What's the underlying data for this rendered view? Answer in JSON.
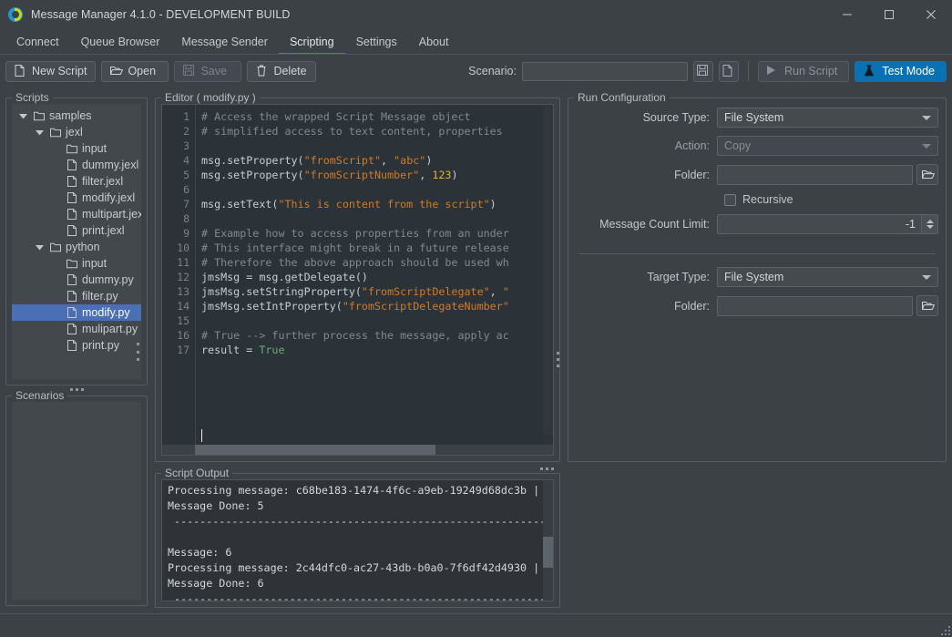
{
  "window": {
    "title": "Message Manager 4.1.0 - DEVELOPMENT BUILD",
    "minimize": "minimize-icon",
    "maximize": "maximize-icon",
    "close": "close-icon"
  },
  "tabs": [
    {
      "label": "Connect",
      "active": false
    },
    {
      "label": "Queue Browser",
      "active": false
    },
    {
      "label": "Message Sender",
      "active": false
    },
    {
      "label": "Scripting",
      "active": true
    },
    {
      "label": "Settings",
      "active": false
    },
    {
      "label": "About",
      "active": false
    }
  ],
  "toolbar": {
    "new_script": "New Script",
    "open": "Open",
    "save": "Save",
    "delete": "Delete",
    "scenario_label": "Scenario:",
    "scenario_value": "",
    "scenario_placeholder": "",
    "save_scenario_icon": "floppy-disk-icon",
    "new_scenario_icon": "new-file-icon",
    "run_script": "Run Script",
    "test_mode": "Test Mode",
    "accent_color": "#0a72b3"
  },
  "scripts_panel": {
    "title": "Scripts",
    "tree": [
      {
        "label": "samples",
        "depth": 0,
        "type": "folder",
        "expanded": true,
        "selected": false
      },
      {
        "label": "jexl",
        "depth": 1,
        "type": "folder",
        "expanded": true,
        "selected": false
      },
      {
        "label": "input",
        "depth": 2,
        "type": "folder",
        "expanded": null,
        "selected": false
      },
      {
        "label": "dummy.jexl",
        "depth": 2,
        "type": "file",
        "expanded": null,
        "selected": false
      },
      {
        "label": "filter.jexl",
        "depth": 2,
        "type": "file",
        "expanded": null,
        "selected": false
      },
      {
        "label": "modify.jexl",
        "depth": 2,
        "type": "file",
        "expanded": null,
        "selected": false
      },
      {
        "label": "multipart.jexl",
        "depth": 2,
        "type": "file",
        "expanded": null,
        "selected": false
      },
      {
        "label": "print.jexl",
        "depth": 2,
        "type": "file",
        "expanded": null,
        "selected": false
      },
      {
        "label": "python",
        "depth": 1,
        "type": "folder",
        "expanded": true,
        "selected": false
      },
      {
        "label": "input",
        "depth": 2,
        "type": "folder",
        "expanded": null,
        "selected": false
      },
      {
        "label": "dummy.py",
        "depth": 2,
        "type": "file",
        "expanded": null,
        "selected": false
      },
      {
        "label": "filter.py",
        "depth": 2,
        "type": "file",
        "expanded": null,
        "selected": false
      },
      {
        "label": "modify.py",
        "depth": 2,
        "type": "file",
        "expanded": null,
        "selected": true
      },
      {
        "label": "mulipart.py",
        "depth": 2,
        "type": "file",
        "expanded": null,
        "selected": false
      },
      {
        "label": "print.py",
        "depth": 2,
        "type": "file",
        "expanded": null,
        "selected": false
      }
    ]
  },
  "scenarios_panel": {
    "title": "Scenarios",
    "items": []
  },
  "editor": {
    "title": "Editor ( modify.py )",
    "filename": "modify.py",
    "line_count": 17,
    "lines": [
      {
        "n": 1,
        "text": "# Access the wrapped Script Message object"
      },
      {
        "n": 2,
        "text": "# simplified access to text content, properties"
      },
      {
        "n": 3,
        "text": ""
      },
      {
        "n": 4,
        "text": "msg.setProperty(\"fromScript\", \"abc\")"
      },
      {
        "n": 5,
        "text": "msg.setProperty(\"fromScriptNumber\", 123)"
      },
      {
        "n": 6,
        "text": ""
      },
      {
        "n": 7,
        "text": "msg.setText(\"This is content from the script\")"
      },
      {
        "n": 8,
        "text": ""
      },
      {
        "n": 9,
        "text": "# Example how to access properties from an under"
      },
      {
        "n": 10,
        "text": "# This interface might break in a future release"
      },
      {
        "n": 11,
        "text": "# Therefore the above approach should be used wh"
      },
      {
        "n": 12,
        "text": "jmsMsg = msg.getDelegate()"
      },
      {
        "n": 13,
        "text": "jmsMsg.setStringProperty(\"fromScriptDelegate\", \""
      },
      {
        "n": 14,
        "text": "jmsMsg.setIntProperty(\"fromScriptDelegateNumber\""
      },
      {
        "n": 15,
        "text": ""
      },
      {
        "n": 16,
        "text": "# True --> further process the message, apply ac"
      },
      {
        "n": 17,
        "text": "result = True"
      }
    ]
  },
  "run_config": {
    "title": "Run Configuration",
    "source_type_label": "Source Type:",
    "source_type_value": "File System",
    "action_label": "Action:",
    "action_value": "Copy",
    "source_folder_label": "Folder:",
    "source_folder_value": "",
    "recursive_label": "Recursive",
    "recursive_checked": false,
    "message_count_limit_label": "Message Count Limit:",
    "message_count_limit_value": "-1",
    "target_type_label": "Target Type:",
    "target_type_value": "File System",
    "target_folder_label": "Folder:",
    "target_folder_value": "",
    "browse_icon": "open-folder-icon"
  },
  "script_output": {
    "title": "Script Output",
    "lines": [
      "Processing message: c68be183-1474-4f6c-a9eb-19249d68dc3b |",
      "Message Done: 5",
      " ----------------------------------------------------------------",
      "",
      "Message: 6",
      "Processing message: 2c44dfc0-ac27-43db-b0a0-7f6df42d4930 |",
      "Message Done: 6",
      " ----------------------------------------------------------------"
    ]
  }
}
